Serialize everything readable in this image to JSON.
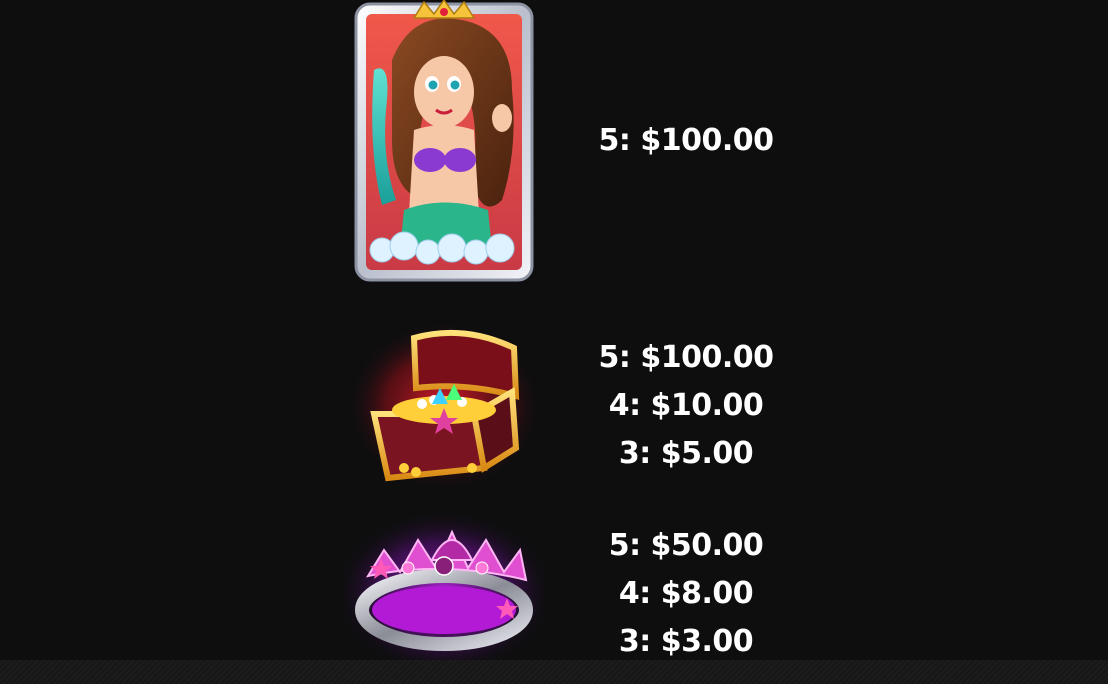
{
  "paytable": {
    "rows": [
      {
        "symbol": "mermaid-icon",
        "pays": [
          "5: $100.00"
        ]
      },
      {
        "symbol": "treasure-chest-icon",
        "pays": [
          "5: $100.00",
          "4: $10.00",
          "3: $5.00"
        ]
      },
      {
        "symbol": "tiara-icon",
        "pays": [
          "5: $50.00",
          "4: $8.00",
          "3: $3.00"
        ]
      }
    ]
  },
  "colors": {
    "background": "#0e0e0f",
    "text": "#ffffff",
    "chest_glow": "#e0182a",
    "tiara_glow": "#b020d8",
    "mermaid_frame": "#d9dde6"
  }
}
